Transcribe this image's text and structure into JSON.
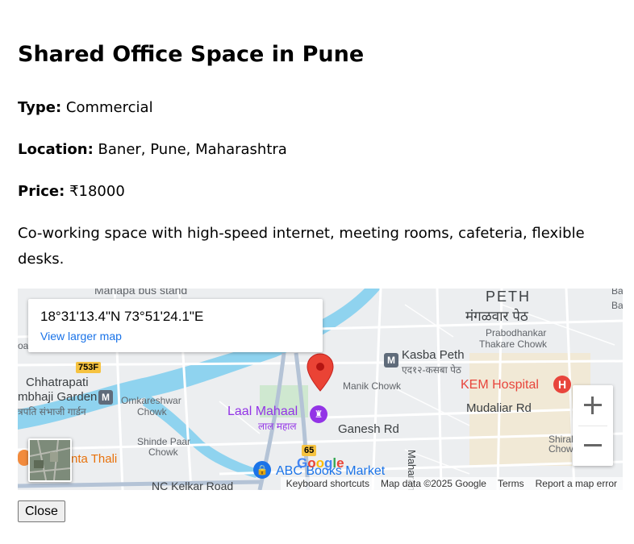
{
  "property": {
    "title": "Shared Office Space in Pune",
    "type_label": "Type:",
    "type_value": "Commercial",
    "location_label": "Location:",
    "location_value": "Baner, Pune, Maharashtra",
    "price_label": "Price:",
    "price_value": "₹18000",
    "description": "Co-working space with high-speed internet, meeting rooms, cafeteria, flexible desks."
  },
  "map": {
    "coords": "18°31'13.4\"N 73°51'24.1\"E",
    "view_larger": "View larger map",
    "google_logo": "Google",
    "attribution": {
      "shortcuts": "Keyboard shortcuts",
      "data": "Map data ©2025 Google",
      "terms": "Terms",
      "report": "Report a map error"
    },
    "labels": {
      "peth": "PETH",
      "peth_mr": "मंगळवार पेठ",
      "prabodhankar": "Prabodhankar",
      "thakare": "Thakare Chowk",
      "kasba": "Kasba Peth",
      "kasba_mr": "एद१२-कसबा पेठ",
      "kem": "KEM Hospital",
      "manik": "Manik Chowk",
      "chhatrapati": "Chhatrapati",
      "sambhaji": "mbhaji Garden",
      "sambhaji_mr": "त्रपति संभाजी गार्डन",
      "omkareshwar": "Omkareshwar",
      "omk_chowk": "Chowk",
      "laal": "Laal Mahaal",
      "laal_mr": "लाल महाल",
      "ganesh": "Ganesh Rd",
      "mudaliar": "Mudaliar Rd",
      "shinde": "Shinde Paar",
      "shinde_chowk": "Chowk",
      "thali": "nta Thali",
      "abc": "ABC Books Market",
      "kelkar": "NC Kelkar Road",
      "maharana": "Maharana",
      "shiral": "Shiral S",
      "shiral2": "Chow",
      "manapa": "Manapa bus stand",
      "route753": "753F",
      "route65": "65",
      "ba": "Ba",
      "oa": "oa"
    },
    "colors": {
      "water": "#8fd3ef",
      "road": "#ffffff",
      "major_road": "#b4c3d6",
      "pin": "#ea4335",
      "hospital": "#e8453c",
      "link": "#1a73e8",
      "poi_purple": "#9334e6"
    }
  },
  "close_button": "Close"
}
